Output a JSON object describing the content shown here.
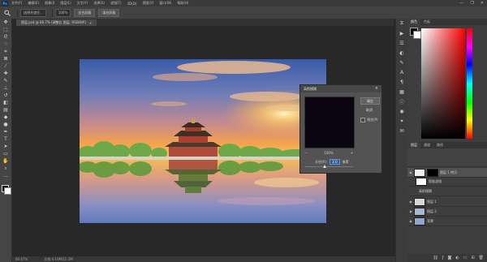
{
  "app": {
    "logo": "Ps"
  },
  "menu": [
    "文件(F)",
    "编辑(E)",
    "图像(I)",
    "图层(L)",
    "文字(Y)",
    "选择(S)",
    "滤镜(T)",
    "3D(D)",
    "视图(V)",
    "窗口(W)",
    "帮助(H)"
  ],
  "window_controls": [
    "—",
    "❐",
    "✕"
  ],
  "options": {
    "mode_box": "选择并遮住...",
    "zoom_value": "100%",
    "buttons": [
      "适合屏幕",
      "填充屏幕"
    ]
  },
  "tab": {
    "title": "图层.psd @ 66.7% (调整后 图层, RGB/8#)",
    "close": "×"
  },
  "status": {
    "zoom": "66.67%",
    "doc": "文档:4.10M/15.2M"
  },
  "dialog": {
    "title": "高斯模糊",
    "close": "×",
    "ok": "确定",
    "cancel": "取消",
    "preview_label": "预览(P)",
    "zoom_out": "−",
    "zoom_pct": "100%",
    "zoom_in": "+",
    "radius_label": "半径(R):",
    "radius_value": "2.0",
    "radius_unit": "像素",
    "slider_pos": 0.42
  },
  "right_tabs": [
    "颜色",
    "色板"
  ],
  "layers_tabs": [
    "图层",
    "通道",
    "路径"
  ],
  "layers": [
    {
      "name": "图层 1 拷贝",
      "thumb": "#f0f0f0"
    },
    {
      "name": "智能滤镜",
      "thumb": "#ffffff"
    },
    {
      "name": "高斯模糊",
      "thumb": "#2b2b2b"
    },
    {
      "name": "图层 1",
      "thumb": "#d8d8d8"
    },
    {
      "name": "图层 2",
      "thumb": "#a8b6d0"
    },
    {
      "name": "背景",
      "thumb": "#8fa7cc"
    }
  ],
  "colors": {
    "accent": "#31a8ff",
    "fg": "#000000",
    "bg": "#ffffff"
  }
}
